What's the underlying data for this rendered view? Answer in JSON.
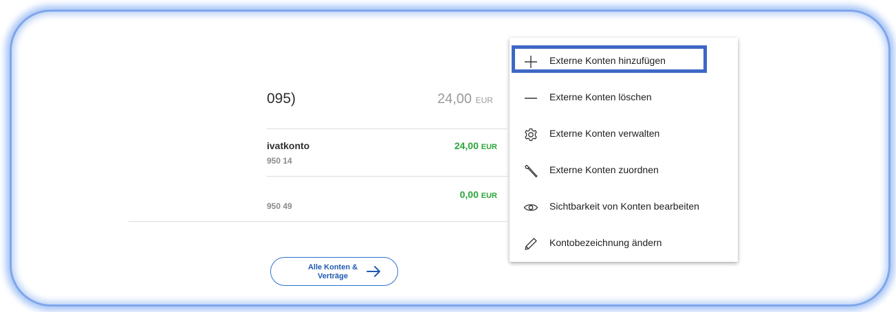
{
  "account": {
    "title": "095)",
    "total_value": "24,00",
    "total_currency": "EUR"
  },
  "rows": [
    {
      "name": "ivatkonto",
      "iban": "950 14",
      "amount": "24,00",
      "currency": "EUR"
    },
    {
      "name": "",
      "iban": "950 49",
      "amount": "0,00",
      "currency": "EUR"
    }
  ],
  "all_accounts_button": {
    "label_line1": "Alle Konten &",
    "label_line2": "Verträge",
    "icon": "arrow-right-icon"
  },
  "menu": {
    "items": [
      {
        "label": "Externe Konten hinzufügen",
        "icon": "plus-icon"
      },
      {
        "label": "Externe Konten löschen",
        "icon": "minus-icon"
      },
      {
        "label": "Externe Konten verwalten",
        "icon": "gear-icon"
      },
      {
        "label": "Externe Konten zuordnen",
        "icon": "wrench-icon"
      },
      {
        "label": "Sichtbarkeit von Konten bearbeiten",
        "icon": "eye-icon"
      },
      {
        "label": "Kontobezeichnung ändern",
        "icon": "pencil-icon"
      }
    ]
  },
  "colors": {
    "positive_amount": "#2aa53a",
    "accent_blue": "#2d6fd0",
    "highlight_border": "#3e68c4",
    "frame_border": "#7ea6ea"
  }
}
